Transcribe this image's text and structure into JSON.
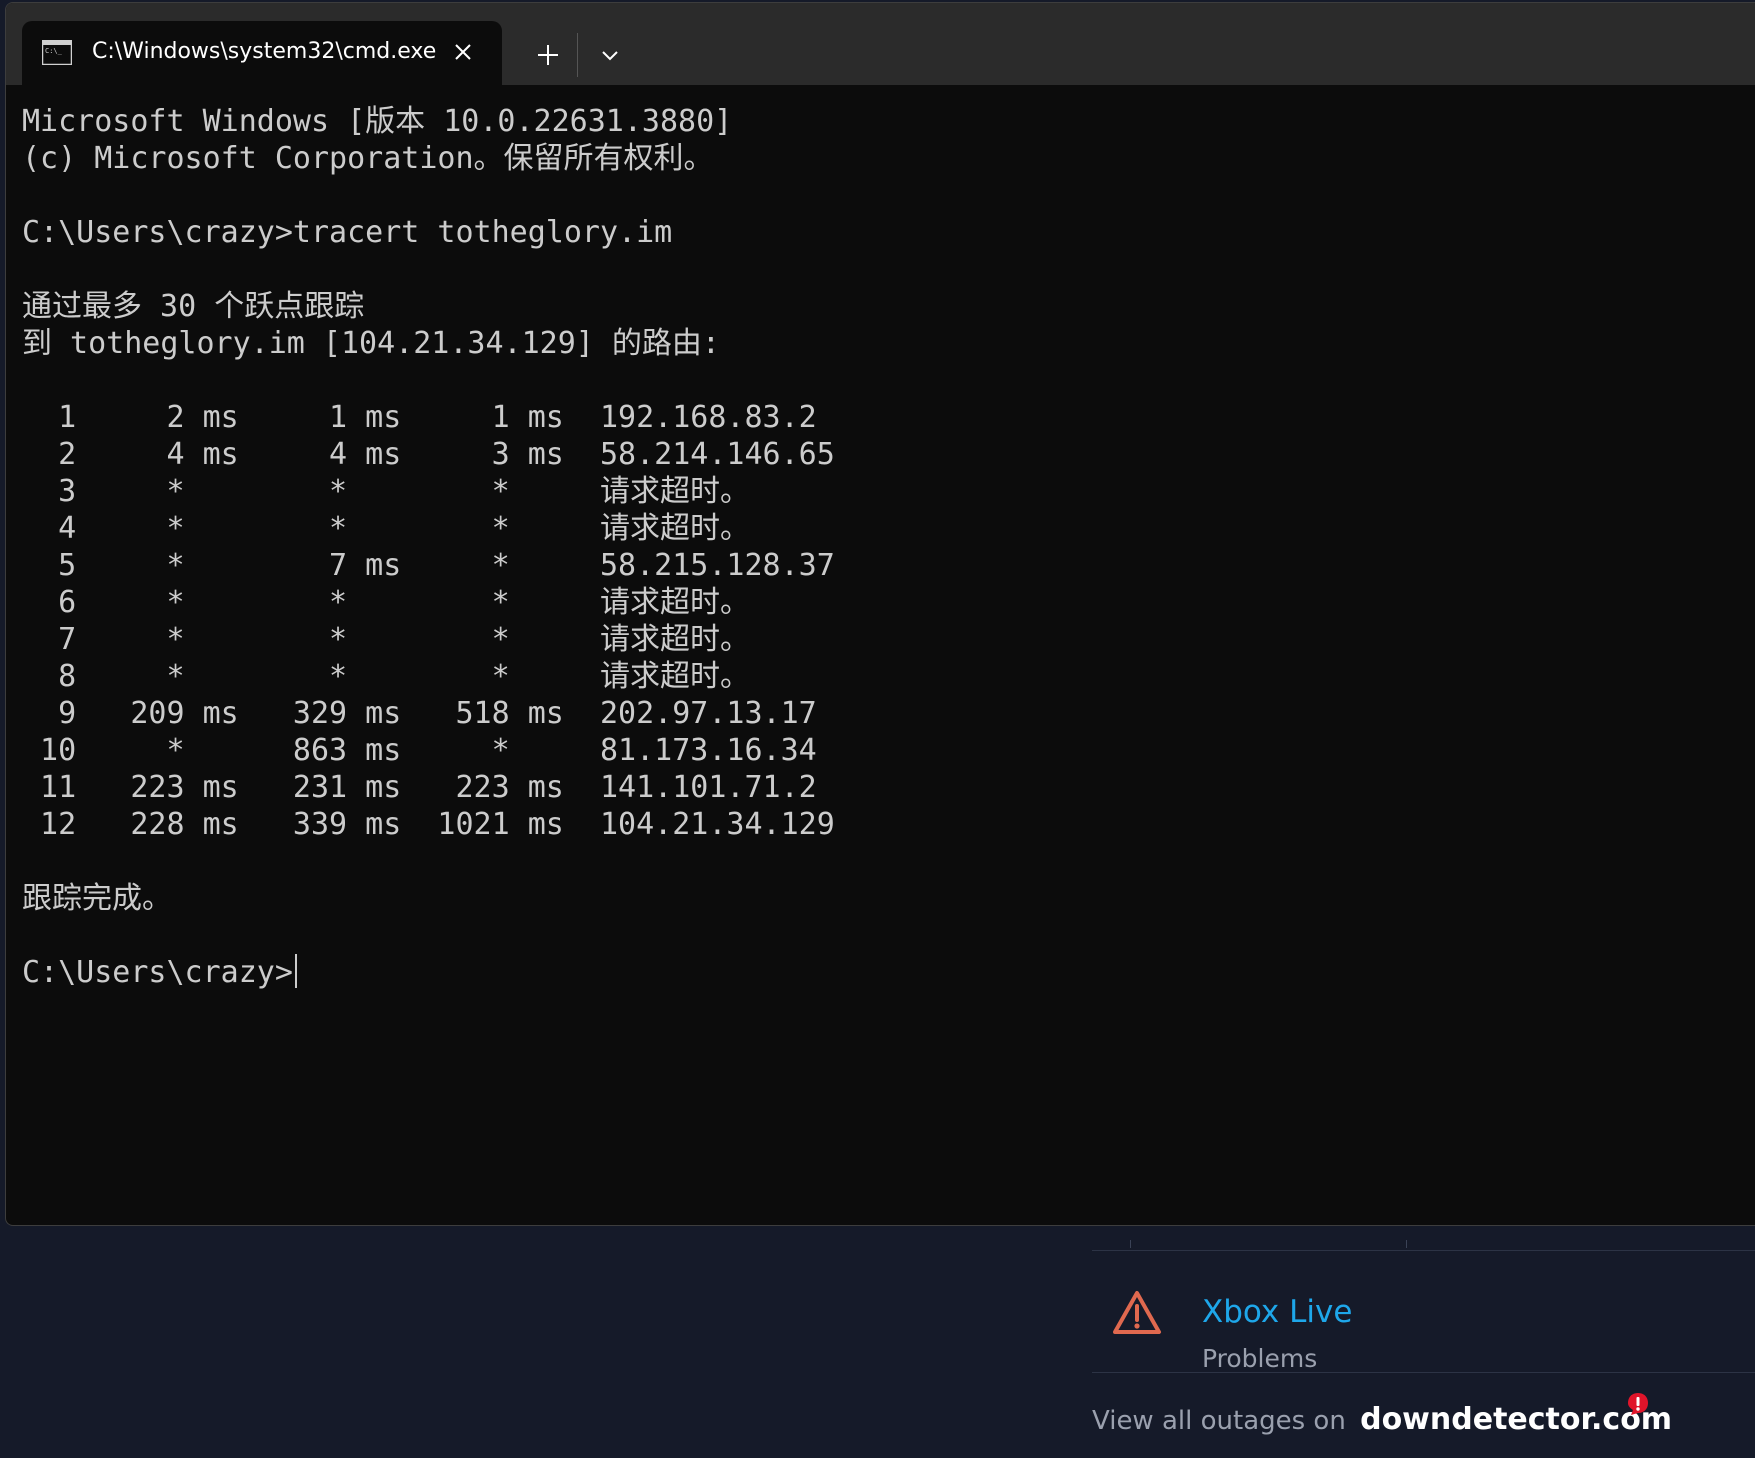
{
  "window": {
    "tab_title": "C:\\Windows\\system32\\cmd.exe",
    "tab_icon": "cmd-icon",
    "close_icon": "close-icon",
    "new_tab_icon": "plus-icon",
    "dropdown_icon": "chevron-down-icon"
  },
  "console": {
    "lines": [
      "Microsoft Windows [版本 10.0.22631.3880]",
      "(c) Microsoft Corporation。保留所有权利。",
      "",
      "C:\\Users\\crazy>tracert totheglory.im",
      "",
      "通过最多 30 个跃点跟踪",
      "到 totheglory.im [104.21.34.129] 的路由:",
      "",
      "  1     2 ms     1 ms     1 ms  192.168.83.2",
      "  2     4 ms     4 ms     3 ms  58.214.146.65",
      "  3     *        *        *     请求超时。",
      "  4     *        *        *     请求超时。",
      "  5     *        7 ms     *     58.215.128.37",
      "  6     *        *        *     请求超时。",
      "  7     *        *        *     请求超时。",
      "  8     *        *        *     请求超时。",
      "  9   209 ms   329 ms   518 ms  202.97.13.17",
      " 10     *      863 ms     *     81.173.16.34",
      " 11   223 ms   231 ms   223 ms  141.101.71.2",
      " 12   228 ms   339 ms  1021 ms  104.21.34.129",
      "",
      "跟踪完成。",
      ""
    ],
    "prompt": "C:\\Users\\crazy>"
  },
  "background": {
    "outage": {
      "service": "Xbox Live",
      "status": "Problems",
      "icon": "warning-icon",
      "icon_color": "#e0694f"
    },
    "footer": {
      "text": "View all outages on",
      "brand": "downdetector.com",
      "badge_icon": "exclamation-badge-icon",
      "badge_color": "#e0142a"
    }
  },
  "colors": {
    "terminal_bg": "#0c0c0c",
    "terminal_text": "#cccccc",
    "titlebar_bg": "#2b2b2b",
    "page_bg": "#151a29",
    "link": "#1ea7ea"
  }
}
